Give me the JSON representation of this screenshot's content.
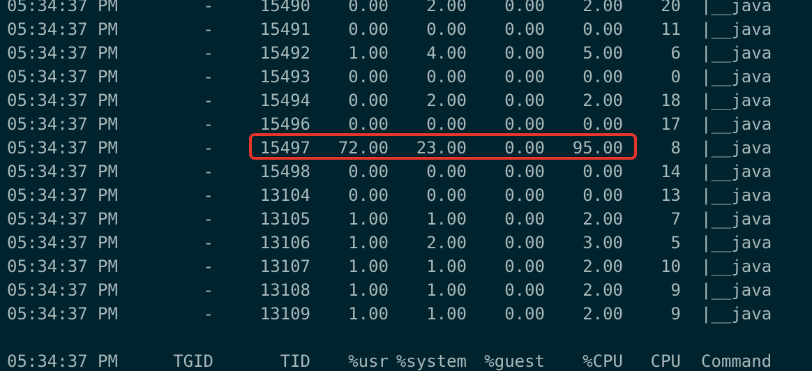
{
  "colors": {
    "background": "#00232e",
    "text": "#a9b8b8",
    "highlight": "#e8352c"
  },
  "rows": [
    {
      "time": "05:34:37 PM",
      "tgid": "-",
      "tid": "15490",
      "usr": "0.00",
      "system": "2.00",
      "guest": "0.00",
      "cpu_pct": "2.00",
      "cpu": "20",
      "command": "|__java"
    },
    {
      "time": "05:34:37 PM",
      "tgid": "-",
      "tid": "15491",
      "usr": "0.00",
      "system": "0.00",
      "guest": "0.00",
      "cpu_pct": "0.00",
      "cpu": "11",
      "command": "|__java"
    },
    {
      "time": "05:34:37 PM",
      "tgid": "-",
      "tid": "15492",
      "usr": "1.00",
      "system": "4.00",
      "guest": "0.00",
      "cpu_pct": "5.00",
      "cpu": "6",
      "command": "|__java"
    },
    {
      "time": "05:34:37 PM",
      "tgid": "-",
      "tid": "15493",
      "usr": "0.00",
      "system": "0.00",
      "guest": "0.00",
      "cpu_pct": "0.00",
      "cpu": "0",
      "command": "|__java"
    },
    {
      "time": "05:34:37 PM",
      "tgid": "-",
      "tid": "15494",
      "usr": "0.00",
      "system": "2.00",
      "guest": "0.00",
      "cpu_pct": "2.00",
      "cpu": "18",
      "command": "|__java"
    },
    {
      "time": "05:34:37 PM",
      "tgid": "-",
      "tid": "15496",
      "usr": "0.00",
      "system": "0.00",
      "guest": "0.00",
      "cpu_pct": "0.00",
      "cpu": "17",
      "command": "|__java"
    },
    {
      "time": "05:34:37 PM",
      "tgid": "-",
      "tid": "15497",
      "usr": "72.00",
      "system": "23.00",
      "guest": "0.00",
      "cpu_pct": "95.00",
      "cpu": "8",
      "command": "|__java"
    },
    {
      "time": "05:34:37 PM",
      "tgid": "-",
      "tid": "15498",
      "usr": "0.00",
      "system": "0.00",
      "guest": "0.00",
      "cpu_pct": "0.00",
      "cpu": "14",
      "command": "|__java"
    },
    {
      "time": "05:34:37 PM",
      "tgid": "-",
      "tid": "13104",
      "usr": "0.00",
      "system": "0.00",
      "guest": "0.00",
      "cpu_pct": "0.00",
      "cpu": "13",
      "command": "|__java"
    },
    {
      "time": "05:34:37 PM",
      "tgid": "-",
      "tid": "13105",
      "usr": "1.00",
      "system": "1.00",
      "guest": "0.00",
      "cpu_pct": "2.00",
      "cpu": "7",
      "command": "|__java"
    },
    {
      "time": "05:34:37 PM",
      "tgid": "-",
      "tid": "13106",
      "usr": "1.00",
      "system": "2.00",
      "guest": "0.00",
      "cpu_pct": "3.00",
      "cpu": "5",
      "command": "|__java"
    },
    {
      "time": "05:34:37 PM",
      "tgid": "-",
      "tid": "13107",
      "usr": "1.00",
      "system": "1.00",
      "guest": "0.00",
      "cpu_pct": "2.00",
      "cpu": "10",
      "command": "|__java"
    },
    {
      "time": "05:34:37 PM",
      "tgid": "-",
      "tid": "13108",
      "usr": "1.00",
      "system": "1.00",
      "guest": "0.00",
      "cpu_pct": "2.00",
      "cpu": "9",
      "command": "|__java"
    },
    {
      "time": "05:34:37 PM",
      "tgid": "-",
      "tid": "13109",
      "usr": "1.00",
      "system": "1.00",
      "guest": "0.00",
      "cpu_pct": "2.00",
      "cpu": "9",
      "command": "|__java"
    }
  ],
  "header": {
    "time": "05:34:37 PM",
    "tgid": "TGID",
    "tid": "TID",
    "usr": "%usr",
    "system": "%system",
    "guest": "%guest",
    "cpu_pct": "%CPU",
    "cpu": "CPU",
    "command": "Command"
  }
}
